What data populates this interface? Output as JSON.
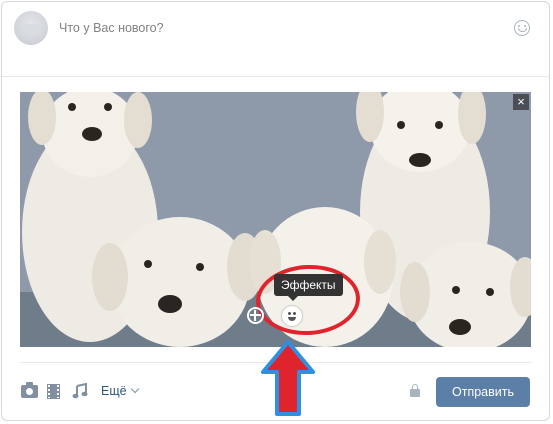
{
  "composer": {
    "placeholder": "Что у Вас нового?"
  },
  "attachment": {
    "close_label": "×",
    "tooltip": "Эффекты"
  },
  "toolbar": {
    "more_label": "Ещё",
    "send_label": "Отправить"
  },
  "icons": [
    "avatar",
    "emoji-icon",
    "close-icon",
    "add-icon",
    "effects-icon",
    "camera-icon",
    "video-icon",
    "music-icon",
    "chevron-down-icon",
    "lock-icon"
  ],
  "colors": {
    "send_button": "#5b7fa6",
    "link": "#2a5885",
    "annotation_red": "#e0242d",
    "annotation_blue": "#2f8fe0"
  }
}
